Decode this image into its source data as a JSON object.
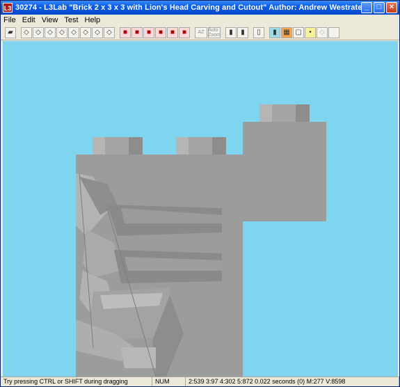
{
  "window": {
    "app_icon_text": "L3",
    "title": "30274 - L3Lab  \"Brick  2  x  3  x  3 with Lion's Head Carving and Cutout\"  Author: Andrew Westrate",
    "minimize": "_",
    "maximize": "□",
    "close": "×"
  },
  "menu": [
    "File",
    "Edit",
    "View",
    "Test",
    "Help"
  ],
  "toolbar": {
    "az_label": "AZ",
    "auto_label": "Auto Zoom"
  },
  "status": {
    "message": "Try pressing CTRL or SHIFT during dragging",
    "num": "NUM",
    "stats": "2:539 3:97 4:302 5:872 0.022 seconds (0) M:277 V:8598"
  },
  "colors": {
    "viewport_bg": "#7fd5ef",
    "brick_gray": "#9c9c9c"
  }
}
